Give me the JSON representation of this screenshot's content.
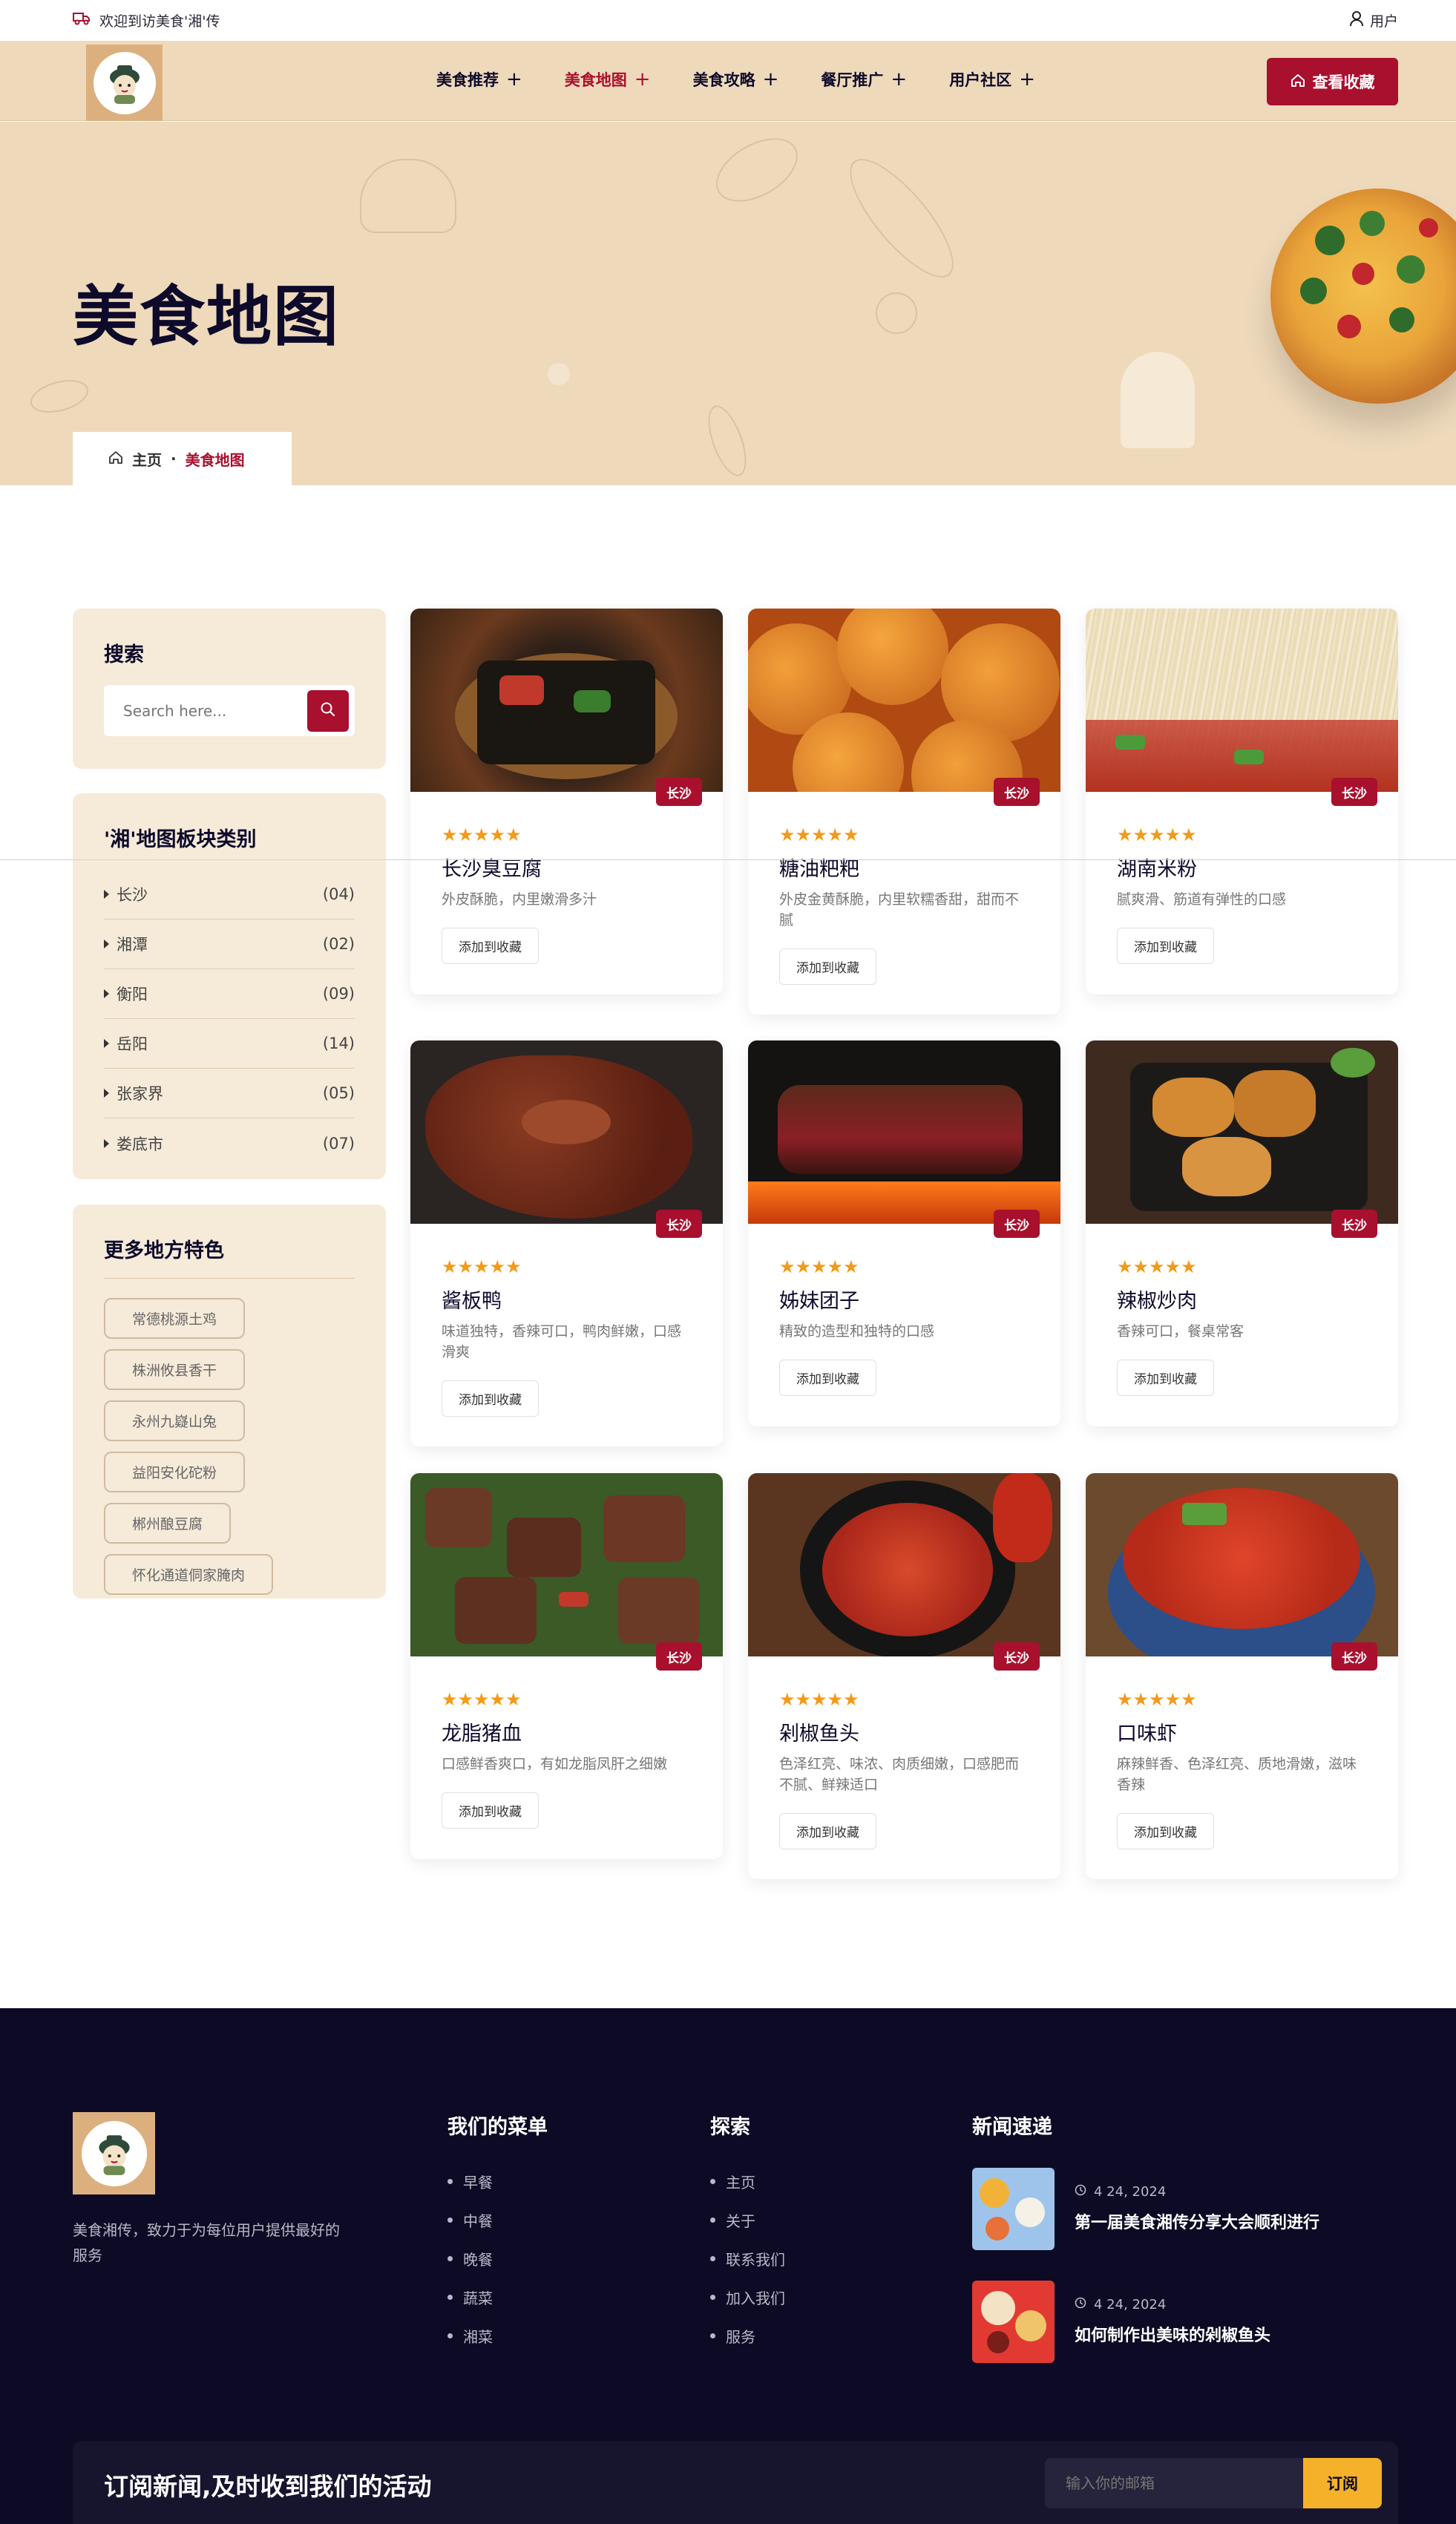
{
  "topbar": {
    "welcome": "欢迎到访美食'湘'传",
    "user": "用户"
  },
  "nav": {
    "items": [
      {
        "label": "美食推荐",
        "active": false
      },
      {
        "label": "美食地图",
        "active": true
      },
      {
        "label": "美食攻略",
        "active": false
      },
      {
        "label": "餐厅推广",
        "active": false
      },
      {
        "label": "用户社区",
        "active": false
      }
    ],
    "fav_button": "查看收藏"
  },
  "hero": {
    "title": "美食地图",
    "breadcrumb_home": "主页",
    "breadcrumb_sep": "·",
    "breadcrumb_current": "美食地图"
  },
  "sidebar": {
    "search_title": "搜索",
    "search_placeholder": "Search here...",
    "category_title": "'湘'地图板块类别",
    "categories": [
      {
        "name": "长沙",
        "count": "(04)"
      },
      {
        "name": "湘潭",
        "count": "(02)"
      },
      {
        "name": "衡阳",
        "count": "(09)"
      },
      {
        "name": "岳阳",
        "count": "(14)"
      },
      {
        "name": "张家界",
        "count": "(05)"
      },
      {
        "name": "娄底市",
        "count": "(07)"
      }
    ],
    "more_title": "更多地方特色",
    "tags": [
      "常德桃源土鸡",
      "株洲攸县香干",
      "永州九嶷山兔",
      "益阳安化砣粉",
      "郴州酿豆腐",
      "怀化通道侗家腌肉"
    ]
  },
  "cards": [
    {
      "name": "长沙臭豆腐",
      "desc": "外皮酥脆，内里嫩滑多汁",
      "badge": "长沙",
      "rating": 5,
      "add": "添加到收藏"
    },
    {
      "name": "糖油粑粑",
      "desc": "外皮金黄酥脆，内里软糯香甜，甜而不腻",
      "badge": "长沙",
      "rating": 5,
      "add": "添加到收藏"
    },
    {
      "name": "湖南米粉",
      "desc": "腻爽滑、筋道有弹性的口感",
      "badge": "长沙",
      "rating": 5,
      "add": "添加到收藏"
    },
    {
      "name": "酱板鸭",
      "desc": "味道独特，香辣可口，鸭肉鲜嫩，口感滑爽",
      "badge": "长沙",
      "rating": 5,
      "add": "添加到收藏"
    },
    {
      "name": "姊妹团子",
      "desc": "精致的造型和独特的口感",
      "badge": "长沙",
      "rating": 5,
      "add": "添加到收藏"
    },
    {
      "name": "辣椒炒肉",
      "desc": "香辣可口，餐桌常客",
      "badge": "长沙",
      "rating": 5,
      "add": "添加到收藏"
    },
    {
      "name": "龙脂猪血",
      "desc": "口感鲜香爽口，有如龙脂凤肝之细嫩",
      "badge": "长沙",
      "rating": 5,
      "add": "添加到收藏"
    },
    {
      "name": "剁椒鱼头",
      "desc": "色泽红亮、味浓、肉质细嫩，口感肥而不腻、鲜辣适口",
      "badge": "长沙",
      "rating": 5,
      "add": "添加到收藏"
    },
    {
      "name": "口味虾",
      "desc": "麻辣鲜香、色泽红亮、质地滑嫩，滋味香辣",
      "badge": "长沙",
      "rating": 5,
      "add": "添加到收藏"
    }
  ],
  "footer": {
    "desc": "美食湘传，致力于为每位用户提供最好的服务",
    "menu_title": "我们的菜单",
    "menu": [
      "早餐",
      "中餐",
      "晚餐",
      "蔬菜",
      "湘菜"
    ],
    "explore_title": "探索",
    "explore": [
      "主页",
      "关于",
      "联系我们",
      "加入我们",
      "服务"
    ],
    "news_title": "新闻速递",
    "news": [
      {
        "date": "4 24, 2024",
        "title": "第一届美食湘传分享大会顺利进行"
      },
      {
        "date": "4 24, 2024",
        "title": "如何制作出美味的剁椒鱼头"
      }
    ],
    "subscribe_title": "订阅新闻,及时收到我们的活动",
    "email_placeholder": "输入你的邮箱",
    "subscribe_button": "订阅"
  },
  "colors": {
    "accent": "#a8102e",
    "hero_bg": "#eed9bb",
    "sidebar_bg": "#f6ead9",
    "footer_bg": "#0d0a25",
    "star": "#f39a19",
    "subscribe_button": "#f6b12a"
  },
  "icons": {
    "topbar_welcome": "truck-icon",
    "topbar_user": "user-icon",
    "fav_button": "home-icon",
    "breadcrumb": "home-icon",
    "search": "search-icon",
    "news_date": "clock-icon"
  }
}
